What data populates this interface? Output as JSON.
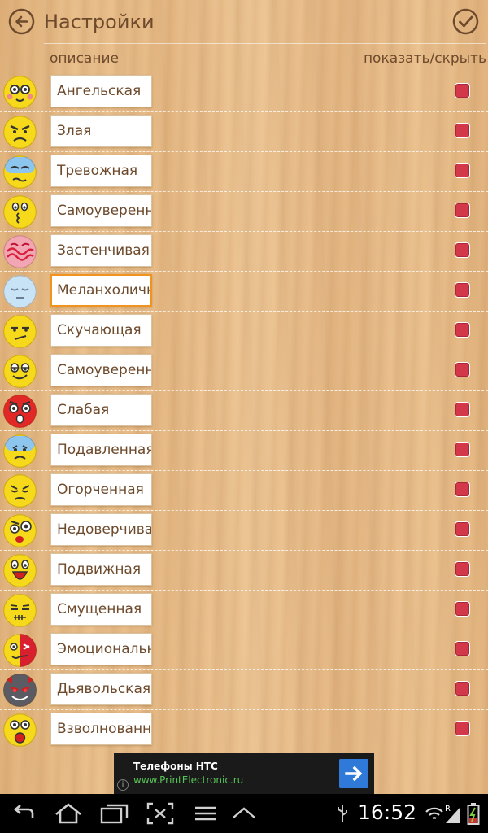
{
  "header": {
    "title": "Настройки"
  },
  "columns": {
    "description": "описание",
    "show_hide": "показать/скрыть"
  },
  "rows": [
    {
      "label": "Ангельская",
      "icon": "angel-face-icon",
      "checked": true
    },
    {
      "label": "Злая",
      "icon": "angry-face-icon",
      "checked": true
    },
    {
      "label": "Тревожная",
      "icon": "anxious-face-icon",
      "checked": true
    },
    {
      "label": "Самоуверенн",
      "icon": "smug-face-icon",
      "checked": true
    },
    {
      "label": "Застенчивая",
      "icon": "shy-face-icon",
      "checked": true
    },
    {
      "label": "Меланхоличн",
      "icon": "melancholic-face-icon",
      "checked": true,
      "focused": true
    },
    {
      "label": "Скучающая",
      "icon": "bored-face-icon",
      "checked": true
    },
    {
      "label": "Самоуверенн",
      "icon": "confident-face-icon",
      "checked": true
    },
    {
      "label": "Слабая",
      "icon": "weak-face-icon",
      "checked": true
    },
    {
      "label": "Подавленная",
      "icon": "depressed-face-icon",
      "checked": true
    },
    {
      "label": "Огорченная",
      "icon": "upset-face-icon",
      "checked": true
    },
    {
      "label": "Недоверчива",
      "icon": "suspicious-face-icon",
      "checked": true
    },
    {
      "label": "Подвижная",
      "icon": "lively-face-icon",
      "checked": true
    },
    {
      "label": "Смущенная",
      "icon": "embarrassed-face-icon",
      "checked": true
    },
    {
      "label": "Эмоциональн",
      "icon": "emotional-face-icon",
      "checked": true
    },
    {
      "label": "Дьявольская",
      "icon": "devil-face-icon",
      "checked": true
    },
    {
      "label": "Взволнованн",
      "icon": "excited-face-icon",
      "checked": true
    }
  ],
  "ad": {
    "title": "Телефоны HTC",
    "url": "www.PrintElectronic.ru",
    "info": "i"
  },
  "statusbar": {
    "time": "16:52",
    "signal_badge": "R"
  },
  "colors": {
    "text": "#6e4a2c",
    "checkbox": "#d2374a",
    "focus": "#f0941f",
    "ad_link": "#58c457",
    "ad_button": "#2f79d8"
  }
}
